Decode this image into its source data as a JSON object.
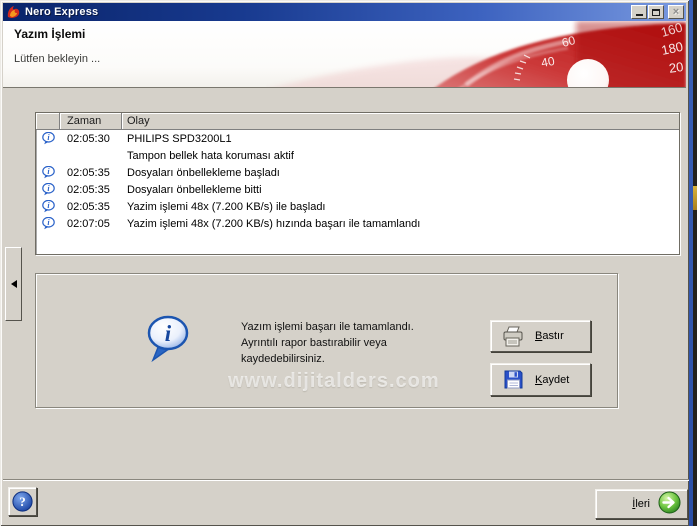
{
  "window": {
    "title": "Nero Express",
    "controls": {
      "close": "×"
    }
  },
  "colors": {
    "titlebar_start": "#0a246a",
    "titlebar_end": "#7a9ae0",
    "dialog_bg": "#d5d1c9",
    "info_blue": "#2a62c9",
    "nero_red": "#b30d0d",
    "next_green": "#2da12d"
  },
  "header": {
    "title": "Yazım İşlemi",
    "subtitle": "Lütfen bekleyin ...",
    "dial_numbers": [
      "60",
      "40",
      "160",
      "180",
      "20"
    ]
  },
  "log": {
    "columns": {
      "time": "Zaman",
      "event": "Olay"
    },
    "rows": [
      {
        "time": "02:05:30",
        "event": "PHILIPS SPD3200L1"
      },
      {
        "time": "",
        "event": "Tampon bellek hata koruması aktif"
      },
      {
        "time": "02:05:35",
        "event": "Dosyaları önbellekleme başladı"
      },
      {
        "time": "02:05:35",
        "event": "Dosyaları önbellekleme bitti"
      },
      {
        "time": "02:05:35",
        "event": "Yazim işlemi 48x (7.200 KB/s) ile başladı"
      },
      {
        "time": "02:07:05",
        "event": "Yazim işlemi 48x (7.200 KB/s) hızında başarı ile tamamlandı"
      }
    ]
  },
  "result_panel": {
    "line1": "Yazım işlemi başarı ile tamamlandı.",
    "line2": "Ayrıntılı rapor bastırabilir veya",
    "line3": "kaydedebilirsiniz.",
    "print_key": "B",
    "print_rest": "astır",
    "save_key": "K",
    "save_rest": "aydet"
  },
  "watermark": "www.dijitalders.com",
  "footer": {
    "help_glyph": "?",
    "next_key": "İ",
    "next_rest": "leri"
  }
}
